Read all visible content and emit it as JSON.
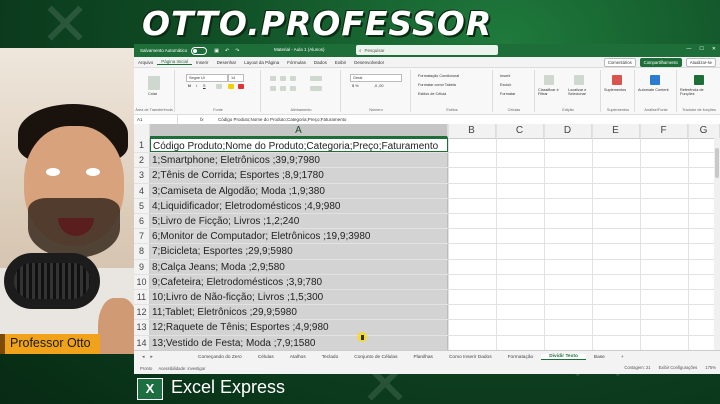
{
  "banner": {
    "title": "OTTO.PROFESSOR"
  },
  "presenter": {
    "name": "Professor Otto"
  },
  "footer": {
    "logo_letter": "X",
    "title": "Excel Express"
  },
  "excel": {
    "titlebar": {
      "autosave": "Salvamento Automático",
      "document": "Material - Aula 1 (Alunos)",
      "search_placeholder": "Pesquisar",
      "controls": [
        "—",
        "☐",
        "✕"
      ]
    },
    "menu": {
      "items": [
        "Arquivo",
        "Página Inicial",
        "Inserir",
        "Desenhar",
        "Layout da Página",
        "Fórmulas",
        "Dados",
        "Exibir",
        "Desenvolvedor"
      ],
      "active_index": 1,
      "comments": "Comentários",
      "share": "Compartilhamento",
      "update": "Atualizar-se"
    },
    "ribbon": {
      "groups": [
        "Área de Transferência",
        "Fonte",
        "Alinhamento",
        "Número",
        "Estilos",
        "Células",
        "Edição",
        "Suplementos",
        "Análise/Fonte",
        "Tradutor de funções"
      ],
      "font_name": "Segoe UI",
      "font_size": "14",
      "number_format": "Geral",
      "styles": [
        "Formatação Condicional",
        "Formatar como Tabela",
        "Estilos de Célula"
      ],
      "cells": [
        "Inserir",
        "Excluir",
        "Formatar"
      ],
      "editing": [
        "Classificar e Filtrar",
        "Localizar e Selecionar"
      ],
      "addins": [
        "Suplementos",
        "Automate Content",
        "Referência de Funções"
      ],
      "paste": "Colar"
    },
    "formula_bar": {
      "name_box": "A1",
      "fx": "fx",
      "value": "Código Produto;Nome do Produto;Categoria;Preço;Faturamento"
    },
    "columns": [
      "A",
      "B",
      "C",
      "D",
      "E",
      "F",
      "G"
    ],
    "rows": [
      {
        "n": "1",
        "a": "Código Produto;Nome do Produto;Categoria;Preço;Faturamento"
      },
      {
        "n": "2",
        "a": "1;Smartphone; Eletrônicos  ;39,9;7980"
      },
      {
        "n": "3",
        "a": "2;Tênis de Corrida; Esportes     ;8,9;1780"
      },
      {
        "n": "4",
        "a": "3;Camiseta de Algodão; Moda         ;1,9;380"
      },
      {
        "n": "5",
        "a": "4;Liquidificador; Eletrodomésticos ;4,9;980"
      },
      {
        "n": "6",
        "a": "5;Livro de Ficção; Livros       ;1,2;240"
      },
      {
        "n": "7",
        "a": "6;Monitor de Computador; Eletrônicos  ;19,9;3980"
      },
      {
        "n": "8",
        "a": "7;Bicicleta; Esportes     ;29,9;5980"
      },
      {
        "n": "9",
        "a": "8;Calça Jeans; Moda         ;2,9;580"
      },
      {
        "n": "10",
        "a": "9;Cafeteira; Eletrodomésticos ;3,9;780"
      },
      {
        "n": "11",
        "a": "10;Livro de Não-ficção; Livros       ;1,5;300"
      },
      {
        "n": "12",
        "a": "11;Tablet; Eletrônicos  ;29,9;5980"
      },
      {
        "n": "13",
        "a": "12;Raquete de Tênis; Esportes     ;4,9;980"
      },
      {
        "n": "14",
        "a": "13;Vestido de Festa; Moda         ;7,9;1580"
      }
    ],
    "sheet_tabs": [
      "Começando do Zero",
      "Células",
      "Atalhos",
      "Teclado",
      "Conjunto de Células",
      "Planilhas",
      "Como Inserir Dados",
      "Formatação",
      "Dividir Texto",
      "Base"
    ],
    "active_tab_index": 8,
    "status": {
      "left": [
        "Pronto",
        "Acessibilidade: investigar"
      ],
      "count": "Contagem: 21",
      "display": "Exibir Configurações",
      "zoom": "175%"
    }
  },
  "colors": {
    "excel_green": "#1e6e3a",
    "name_tag": "#f0a21a",
    "background": "#0f4a24"
  }
}
